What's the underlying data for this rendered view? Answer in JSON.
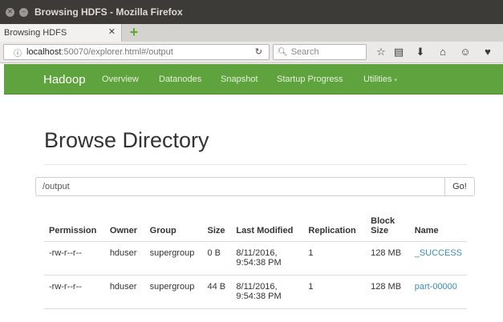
{
  "window": {
    "title": "Browsing HDFS - Mozilla Firefox"
  },
  "tabs": [
    {
      "label": "Browsing HDFS"
    }
  ],
  "urlbar": {
    "host": "localhost",
    "rest": ":50070/explorer.html#/output"
  },
  "search": {
    "placeholder": "Search"
  },
  "nav": {
    "brand": "Hadoop",
    "items": [
      "Overview",
      "Datanodes",
      "Snapshot",
      "Startup Progress",
      "Utilities"
    ]
  },
  "page": {
    "title": "Browse Directory",
    "path_value": "/output",
    "go_label": "Go!"
  },
  "table": {
    "headers": [
      "Permission",
      "Owner",
      "Group",
      "Size",
      "Last Modified",
      "Replication",
      "Block Size",
      "Name"
    ],
    "rows": [
      {
        "permission": "-rw-r--r--",
        "owner": "hduser",
        "group": "supergroup",
        "size": "0 B",
        "modified_date": "8/11/2016,",
        "modified_time": "9:54:38 PM",
        "replication": "1",
        "block_size": "128 MB",
        "name": "_SUCCESS"
      },
      {
        "permission": "-rw-r--r--",
        "owner": "hduser",
        "group": "supergroup",
        "size": "44 B",
        "modified_date": "8/11/2016,",
        "modified_time": "9:54:38 PM",
        "replication": "1",
        "block_size": "128 MB",
        "name": "part-00000"
      }
    ]
  },
  "colors": {
    "hadoop_green": "#5fa33e",
    "link_blue": "#3c8dbc",
    "titlebar": "#3c3b37"
  }
}
